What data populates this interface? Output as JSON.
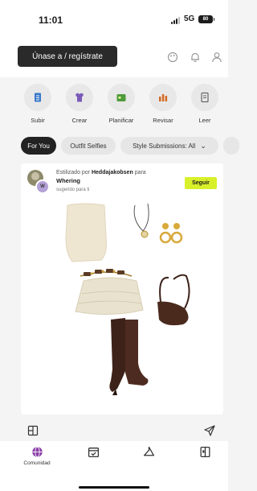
{
  "status_bar": {
    "time": "11:01",
    "network": "5G",
    "battery": "80"
  },
  "header": {
    "join_label": "Únase a / regístrate",
    "icons": [
      "palette-icon",
      "bell-icon",
      "profile-icon"
    ]
  },
  "actions": [
    {
      "label": "Subir",
      "icon": "upload-icon",
      "color": "#3a78c8"
    },
    {
      "label": "Crear",
      "icon": "create-icon",
      "color": "#7a5bb8"
    },
    {
      "label": "Planificar",
      "icon": "calendar-icon",
      "color": "#4e9b3a"
    },
    {
      "label": "Revisar",
      "icon": "chart-icon",
      "color": "#d66a24"
    },
    {
      "label": "Leer",
      "icon": "document-icon",
      "color": "#666666"
    }
  ],
  "chips": {
    "for_you": "For You",
    "outfit_selfies": "Outfit Selfies",
    "style_submissions": "Style Submissions: All"
  },
  "post": {
    "styled_prefix": "Estilizado por",
    "author": "Heddajakobsen",
    "styled_suffix": "para",
    "brand": "Whering",
    "suggested": "sugerido para ti",
    "follow_label": "Seguir",
    "follow_color": "#d8f02a"
  },
  "post_actions": {
    "icons": [
      "layout-icon",
      "send-icon"
    ]
  },
  "bottom_nav": {
    "items": [
      {
        "label": "Comunidad",
        "icon": "globe-icon"
      },
      {
        "label": "",
        "icon": "calendar-check-icon"
      },
      {
        "label": "",
        "icon": "hanger-icon"
      },
      {
        "label": "",
        "icon": "wardrobe-icon"
      }
    ]
  }
}
